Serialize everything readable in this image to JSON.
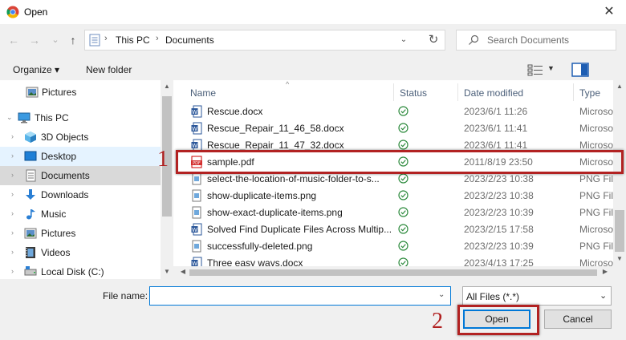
{
  "window": {
    "title": "Open",
    "close_glyph": "✕"
  },
  "nav_buttons": {
    "back": "←",
    "forward": "→",
    "recent": "⌄",
    "up": "↑"
  },
  "address": {
    "crumbs": [
      "This PC",
      "Documents"
    ],
    "separator": "›",
    "dropdown": "⌄",
    "refresh": "↻"
  },
  "search": {
    "placeholder": "Search Documents"
  },
  "toolbar": {
    "organize": "Organize ▾",
    "new_folder": "New folder",
    "view_dropdown": "▼"
  },
  "nav_pane": {
    "items": [
      {
        "label": "Pictures",
        "icon": "pictures-icon"
      },
      {
        "label": "This PC",
        "icon": "computer-icon"
      },
      {
        "label": "3D Objects",
        "icon": "3d-objects-icon"
      },
      {
        "label": "Desktop",
        "icon": "desktop-icon"
      },
      {
        "label": "Documents",
        "icon": "documents-icon"
      },
      {
        "label": "Downloads",
        "icon": "downloads-icon"
      },
      {
        "label": "Music",
        "icon": "music-icon"
      },
      {
        "label": "Pictures",
        "icon": "pictures-icon"
      },
      {
        "label": "Videos",
        "icon": "videos-icon"
      },
      {
        "label": "Local Disk (C:)",
        "icon": "disk-icon"
      }
    ]
  },
  "columns": {
    "name": "Name",
    "status": "Status",
    "date": "Date modified",
    "type": "Type"
  },
  "files": [
    {
      "name": "Rescue.docx",
      "date": "2023/6/1 11:26",
      "type": "Microso",
      "icon": "word-doc-icon"
    },
    {
      "name": "Rescue_Repair_11_46_58.docx",
      "date": "2023/6/1 11:41",
      "type": "Microso",
      "icon": "word-doc-icon"
    },
    {
      "name": "Rescue_Repair_11_47_32.docx",
      "date": "2023/6/1 11:41",
      "type": "Microso",
      "icon": "word-doc-icon"
    },
    {
      "name": "sample.pdf",
      "date": "2011/8/19 23:50",
      "type": "Microso",
      "icon": "pdf-icon"
    },
    {
      "name": "select-the-location-of-music-folder-to-s...",
      "date": "2023/2/23 10:38",
      "type": "PNG File",
      "icon": "image-file-icon"
    },
    {
      "name": "show-duplicate-items.png",
      "date": "2023/2/23 10:38",
      "type": "PNG File",
      "icon": "image-file-icon"
    },
    {
      "name": "show-exact-duplicate-items.png",
      "date": "2023/2/23 10:39",
      "type": "PNG File",
      "icon": "image-file-icon"
    },
    {
      "name": "Solved Find Duplicate Files Across Multip...",
      "date": "2023/2/15 17:58",
      "type": "Microso",
      "icon": "word-doc-icon"
    },
    {
      "name": "successfully-deleted.png",
      "date": "2023/2/23 10:39",
      "type": "PNG File",
      "icon": "image-file-icon"
    },
    {
      "name": "Three easy ways.docx",
      "date": "2023/4/13 17:25",
      "type": "Microso",
      "icon": "word-doc-icon"
    }
  ],
  "bottom": {
    "file_name_label": "File name:",
    "file_name_value": "",
    "file_type": "All Files (*.*)",
    "open_label": "Open",
    "cancel_label": "Cancel"
  },
  "annotations": {
    "step1": "1",
    "step2": "2",
    "color": "#b22222"
  },
  "colors": {
    "selection": "#d9d9d9",
    "hover": "#e5f3ff",
    "accent": "#0078d7",
    "status_ok": "#2e8b3e"
  }
}
